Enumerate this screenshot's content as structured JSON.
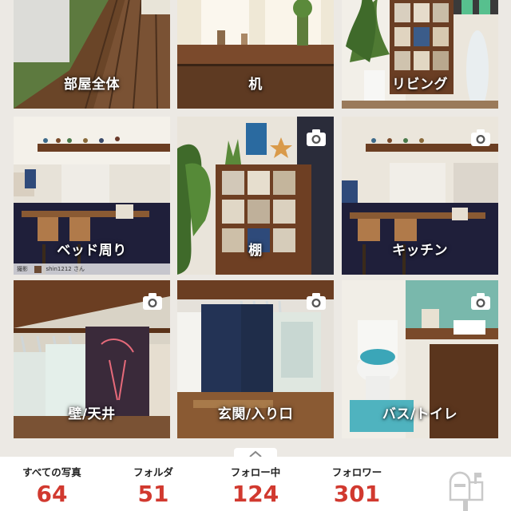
{
  "folders": [
    {
      "label": "部屋全体",
      "camera": false
    },
    {
      "label": "机",
      "camera": false
    },
    {
      "label": "リビング",
      "camera": false
    },
    {
      "label": "ベッド周り",
      "camera": false,
      "credit": {
        "prefix": "撮影",
        "user": "shin1212",
        "suffix": "さん"
      }
    },
    {
      "label": "棚",
      "camera": true
    },
    {
      "label": "キッチン",
      "camera": true
    },
    {
      "label": "壁/天井",
      "camera": true
    },
    {
      "label": "玄関/入り口",
      "camera": true
    },
    {
      "label": "バス/トイレ",
      "camera": true
    }
  ],
  "stats": [
    {
      "label": "すべての写真",
      "value": "64"
    },
    {
      "label": "フォルダ",
      "value": "51"
    },
    {
      "label": "フォロー中",
      "value": "124"
    },
    {
      "label": "フォロワー",
      "value": "301"
    }
  ],
  "icons": {
    "camera": "camera-icon",
    "mailbox": "mailbox-icon",
    "handle": "chevron-up-icon"
  },
  "colors": {
    "stat_value": "#d1392f",
    "background": "#ece9e4"
  }
}
